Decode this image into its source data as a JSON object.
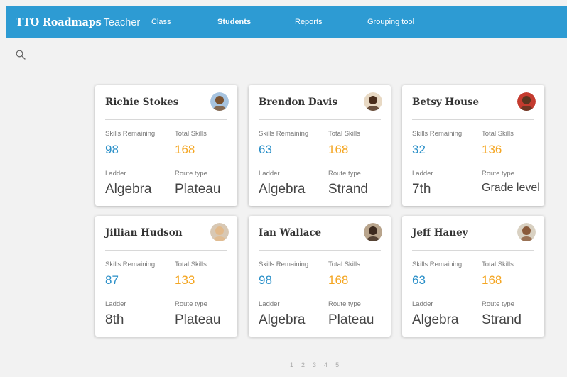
{
  "header": {
    "brand_strong": "TTO Roadmaps",
    "brand_light": "Teacher",
    "nav": [
      {
        "label": "Class"
      },
      {
        "label": "Students"
      },
      {
        "label": "Reports"
      },
      {
        "label": "Grouping tool"
      }
    ]
  },
  "labels": {
    "skills_remaining": "Skills Remaining",
    "total_skills": "Total Skills",
    "ladder": "Ladder",
    "route_type": "Route type"
  },
  "students": [
    {
      "name": "Richie Stokes",
      "skills_remaining": "98",
      "total_skills": "168",
      "ladder": "Algebra",
      "route_type": "Plateau"
    },
    {
      "name": "Brendon Davis",
      "skills_remaining": "63",
      "total_skills": "168",
      "ladder": "Algebra",
      "route_type": "Strand"
    },
    {
      "name": "Betsy House",
      "skills_remaining": "32",
      "total_skills": "136",
      "ladder": "7th",
      "route_type": "Grade level"
    },
    {
      "name": "Jillian Hudson",
      "skills_remaining": "87",
      "total_skills": "133",
      "ladder": "8th",
      "route_type": "Plateau"
    },
    {
      "name": "Ian Wallace",
      "skills_remaining": "98",
      "total_skills": "168",
      "ladder": "Algebra",
      "route_type": "Plateau"
    },
    {
      "name": "Jeff Haney",
      "skills_remaining": "63",
      "total_skills": "168",
      "ladder": "Algebra",
      "route_type": "Strand"
    }
  ],
  "pagination": [
    "1",
    "2",
    "3",
    "4",
    "5"
  ],
  "colors": {
    "header_bg": "#2d9bd3",
    "skills_remaining": "#2a8fc8",
    "total_skills": "#f4a623"
  }
}
